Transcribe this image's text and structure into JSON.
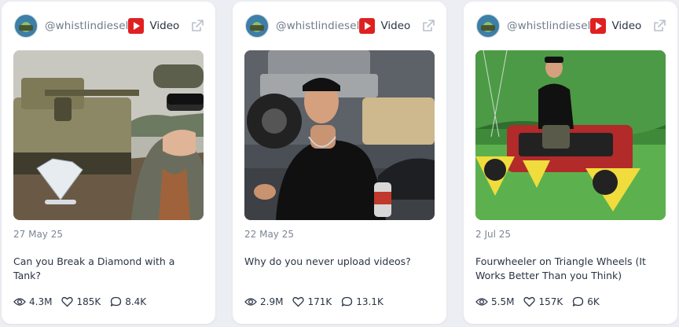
{
  "cards": [
    {
      "handle": "@whistlindiesel",
      "platform_label": "Video",
      "date": "27 May 25",
      "title": "Can you Break a Diamond with a Tank?",
      "views": "4.3M",
      "likes": "185K",
      "comments": "8.4K"
    },
    {
      "handle": "@whistlindiesel",
      "platform_label": "Video",
      "date": "22 May 25",
      "title": "Why do you never upload videos?",
      "views": "2.9M",
      "likes": "171K",
      "comments": "13.1K"
    },
    {
      "handle": "@whistlindiesel",
      "platform_label": "Video",
      "date": "2 Jul 25",
      "title": "Fourwheeler on Triangle Wheels (It Works Better Than you Think)",
      "views": "5.5M",
      "likes": "157K",
      "comments": "6K"
    }
  ],
  "icons": {
    "platform": "youtube-icon",
    "external": "external-link-icon",
    "views": "eye-icon",
    "likes": "heart-icon",
    "comments": "comment-icon"
  },
  "colors": {
    "youtube_red": "#e02020",
    "text_dark": "#2a3444",
    "text_muted": "#7c8594"
  }
}
